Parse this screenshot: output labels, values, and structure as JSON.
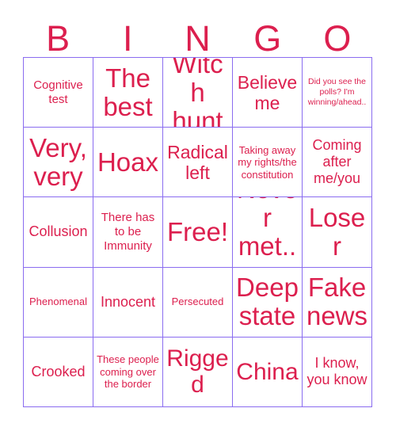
{
  "card": {
    "title": "BINGO",
    "text_color": "#dc1f4e",
    "grid_line_color": "#8a6cf0",
    "background_color": "#ffffff"
  },
  "header": {
    "letters": [
      {
        "label": "B"
      },
      {
        "label": "I"
      },
      {
        "label": "N"
      },
      {
        "label": "G"
      },
      {
        "label": "O"
      }
    ]
  },
  "grid": {
    "rows": 5,
    "columns": 5,
    "cells": [
      {
        "text": "Cognitive test",
        "size": "fs-s"
      },
      {
        "text": "The best",
        "size": "fs-xxl"
      },
      {
        "text": "Witch hunt",
        "size": "fs-xxl"
      },
      {
        "text": "Believe me",
        "size": "fs-l"
      },
      {
        "text": "Did you see the polls? I'm winning/ahead..",
        "size": "fs-xxs"
      },
      {
        "text": "Very, very",
        "size": "fs-xxl"
      },
      {
        "text": "Hoax",
        "size": "fs-xxl"
      },
      {
        "text": "Radical left",
        "size": "fs-l"
      },
      {
        "text": "Taking away my rights/the constitution",
        "size": "fs-xs"
      },
      {
        "text": "Coming after me/you",
        "size": "fs-m"
      },
      {
        "text": "Collusion",
        "size": "fs-m"
      },
      {
        "text": "There has to be Immunity",
        "size": "fs-s"
      },
      {
        "text": "Free!",
        "size": "fs-xxl"
      },
      {
        "text": "Never met...",
        "size": "fs-xxl"
      },
      {
        "text": "Loser",
        "size": "fs-xxl"
      },
      {
        "text": "Phenomenal",
        "size": "fs-xs"
      },
      {
        "text": "Innocent",
        "size": "fs-m"
      },
      {
        "text": "Persecuted",
        "size": "fs-xs"
      },
      {
        "text": "Deep state",
        "size": "fs-xxl"
      },
      {
        "text": "Fake news",
        "size": "fs-xxl"
      },
      {
        "text": "Crooked",
        "size": "fs-m"
      },
      {
        "text": "These people coming over the border",
        "size": "fs-xs"
      },
      {
        "text": "Rigged",
        "size": "fs-xl"
      },
      {
        "text": "China",
        "size": "fs-xl"
      },
      {
        "text": "I know, you know",
        "size": "fs-m"
      }
    ]
  }
}
